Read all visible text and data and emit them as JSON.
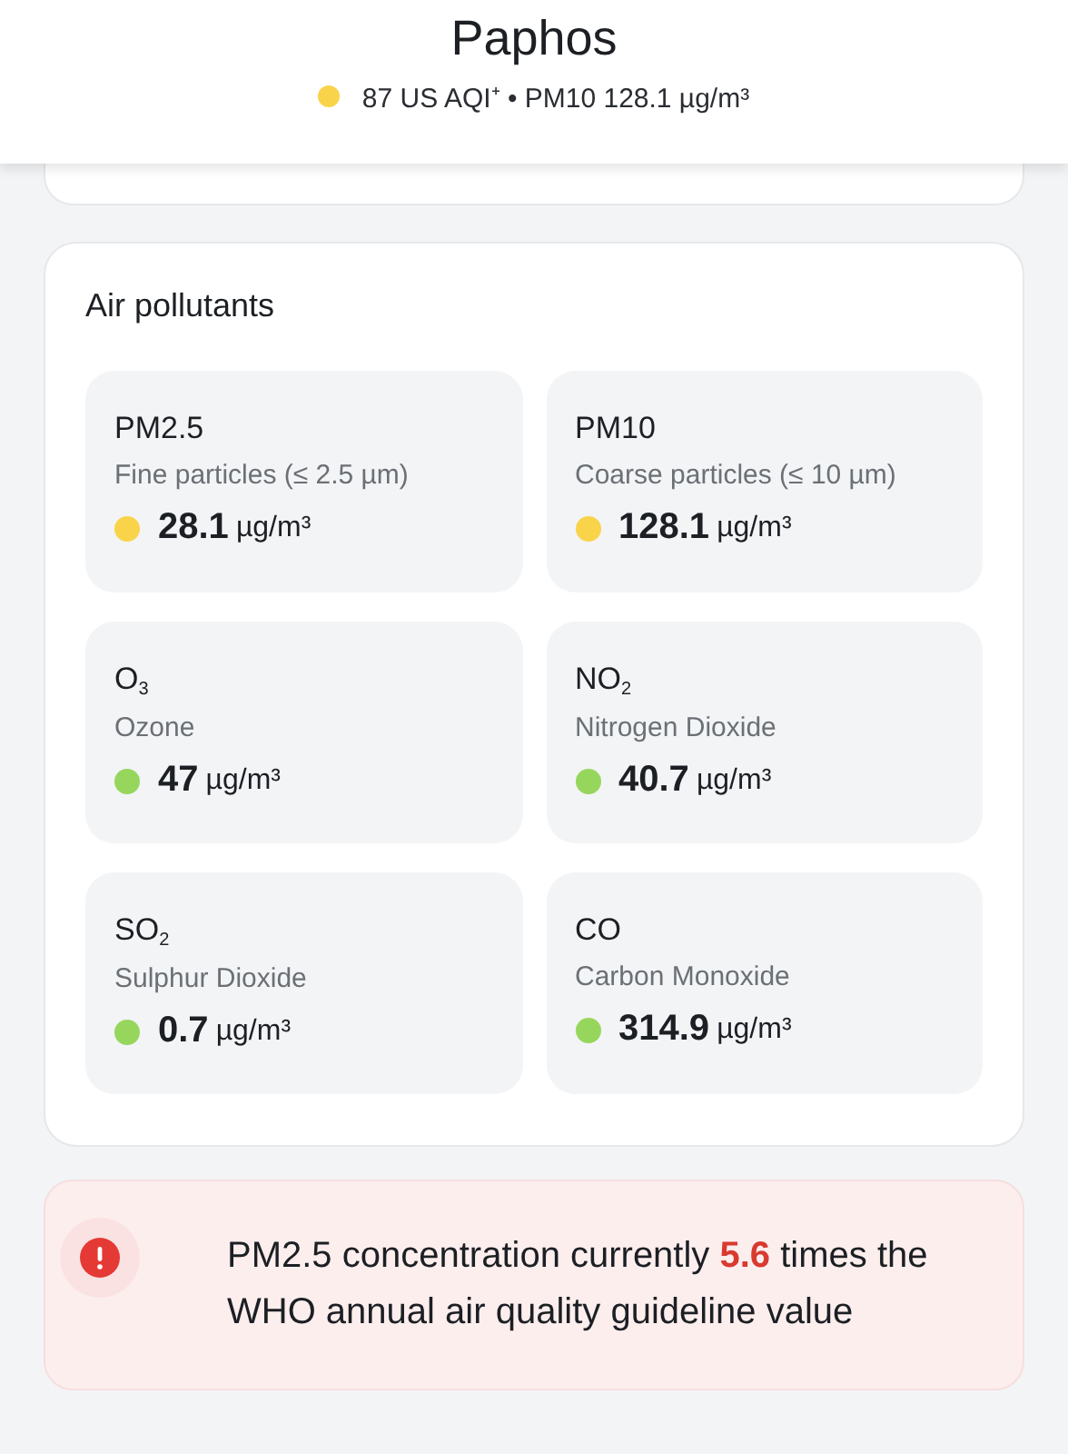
{
  "header": {
    "title": "Paphos",
    "color": "#f9d44a",
    "summary": "87 US AQI⁺ • PM10 128.1 µg/m³"
  },
  "air_pollutants": {
    "title": "Air pollutants",
    "items": [
      {
        "name": "PM2.5",
        "description": "Fine particles (≤ 2.5 µm)",
        "value": "28.1",
        "unit": "µg/m³",
        "color": "#f9d44a"
      },
      {
        "name": "PM10",
        "description": "Coarse particles (≤ 10 µm)",
        "value": "128.1",
        "unit": "µg/m³",
        "color": "#f9d44a"
      },
      {
        "name": "O$_{3}$",
        "description": "Ozone",
        "value": "47",
        "unit": "µg/m³",
        "color": "#97d65c"
      },
      {
        "name": "NO$_{2}$",
        "description": "Nitrogen Dioxide",
        "value": "40.7",
        "unit": "µg/m³",
        "color": "#97d65c"
      },
      {
        "name": "SO$_{2}$",
        "description": "Sulphur Dioxide",
        "value": "0.7",
        "unit": "µg/m³",
        "color": "#97d65c"
      },
      {
        "name": "CO",
        "description": "Carbon Monoxide",
        "value": "314.9",
        "unit": "µg/m³",
        "color": "#97d65c"
      }
    ]
  },
  "alert": {
    "text": "PM2.5 concentration currently **5.6** times the WHO annual air quality guideline value"
  }
}
